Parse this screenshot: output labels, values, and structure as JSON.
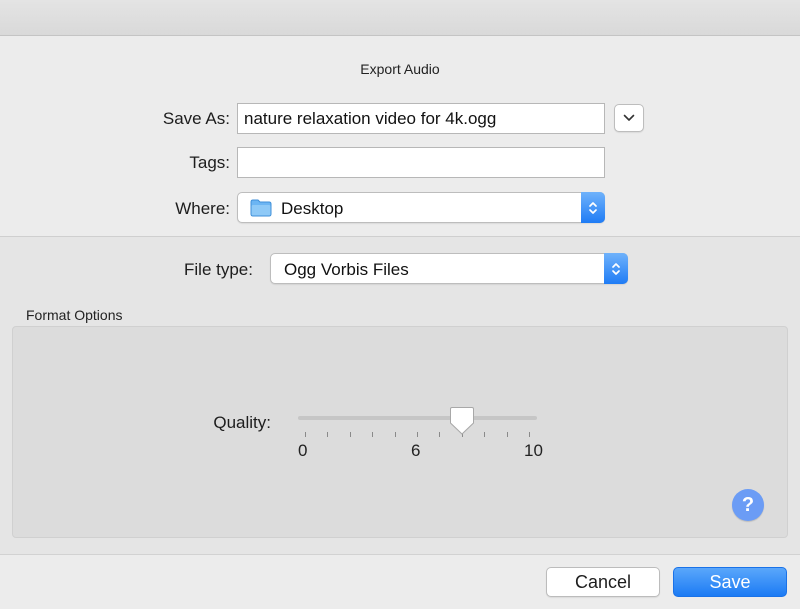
{
  "dialog": {
    "title": "Export Audio"
  },
  "save_as": {
    "label": "Save As:",
    "value": "nature relaxation video for 4k.ogg"
  },
  "tags": {
    "label": "Tags:",
    "value": ""
  },
  "where": {
    "label": "Where:",
    "value": "Desktop",
    "icon": "folder-icon"
  },
  "file_type": {
    "label": "File type:",
    "value": "Ogg Vorbis Files"
  },
  "format_options": {
    "title": "Format Options",
    "quality": {
      "label": "Quality:",
      "value": 7,
      "min": 0,
      "max": 10,
      "tick_labels": [
        "0",
        "6",
        "10"
      ]
    },
    "help": "?"
  },
  "buttons": {
    "cancel": "Cancel",
    "save": "Save"
  },
  "colors": {
    "accent": "#1f7cf5",
    "help": "#6b9cf5"
  }
}
